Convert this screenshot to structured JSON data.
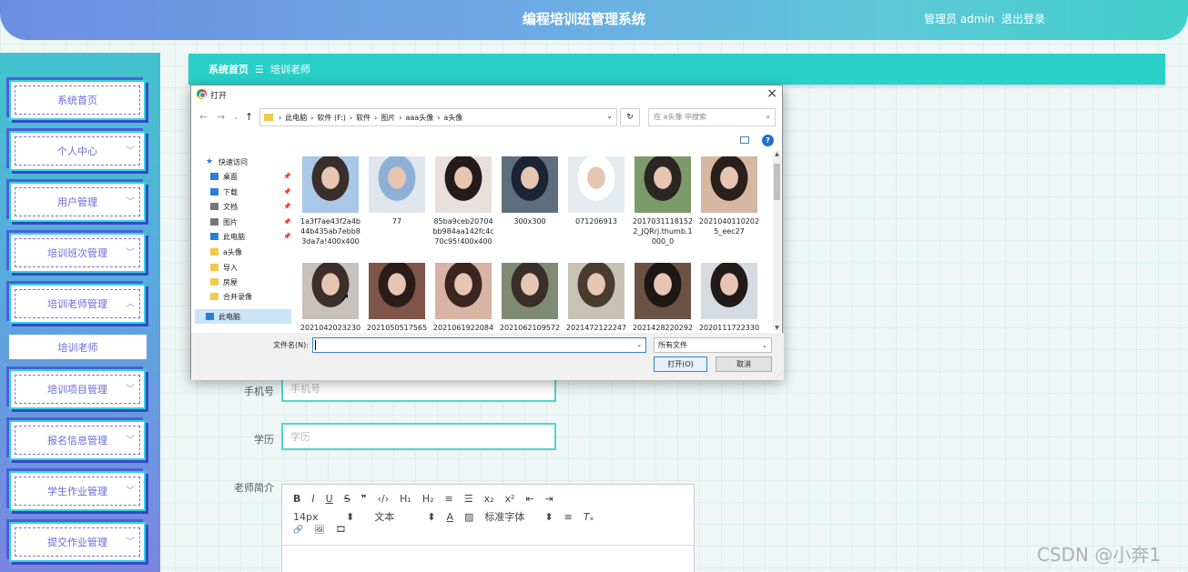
{
  "header": {
    "title": "编程培训班管理系统",
    "user": "管理员 admin",
    "logout": "退出登录"
  },
  "sidebar": {
    "items": [
      {
        "label": "系统首页",
        "chevron": ""
      },
      {
        "label": "个人中心",
        "chevron": "﹀"
      },
      {
        "label": "用户管理",
        "chevron": "﹀"
      },
      {
        "label": "培训班次管理",
        "chevron": "﹀"
      },
      {
        "label": "培训老师管理",
        "chevron": "︿"
      },
      {
        "label": "培训项目管理",
        "chevron": "﹀"
      },
      {
        "label": "报名信息管理",
        "chevron": "﹀"
      },
      {
        "label": "学生作业管理",
        "chevron": "﹀"
      },
      {
        "label": "提交作业管理",
        "chevron": "﹀"
      }
    ],
    "subitem": "培训老师"
  },
  "breadcrumb": {
    "home": "系统首页",
    "sep": "☰",
    "current": "培训老师"
  },
  "form": {
    "phone_label": "手机号",
    "phone_placeholder": "手机号",
    "edu_label": "学历",
    "edu_placeholder": "学历",
    "intro_label": "老师简介"
  },
  "editor": {
    "row1": [
      "B",
      "I",
      "U",
      "S",
      "❞",
      "‹/›",
      "H₁",
      "H₂",
      "≡",
      "☰",
      "x₂",
      "x²",
      "⇤",
      "⇥"
    ],
    "size": "14px",
    "format": "文本",
    "font": "标准字体",
    "row3": [
      "🔗",
      "🖼",
      "🎞"
    ]
  },
  "watermark": "CSDN @小奔1",
  "dialog": {
    "title": "打开",
    "close": "×",
    "path": [
      "此电脑",
      "软件 (F:)",
      "软件",
      "图片",
      "aaa头像",
      "a头像"
    ],
    "search_placeholder": "在 a头像 中搜索",
    "nav": [
      {
        "label": "快速访问",
        "icon": "star-icon",
        "color": "#1e7be0",
        "pin": false
      },
      {
        "label": "桌面",
        "icon": "desktop-icon",
        "color": "#2a7fd4",
        "pin": true
      },
      {
        "label": "下载",
        "icon": "download-icon",
        "color": "#2a7fd4",
        "pin": true
      },
      {
        "label": "文档",
        "icon": "document-icon",
        "color": "#777777",
        "pin": true
      },
      {
        "label": "图片",
        "icon": "pictures-icon",
        "color": "#777777",
        "pin": true
      },
      {
        "label": "此电脑",
        "icon": "computer-icon",
        "color": "#2a7fd4",
        "pin": true
      },
      {
        "label": "a头像",
        "icon": "folder-icon",
        "color": "#f2c94c",
        "pin": false
      },
      {
        "label": "导入",
        "icon": "folder-icon",
        "color": "#f2c94c",
        "pin": false
      },
      {
        "label": "房屋",
        "icon": "folder-icon",
        "color": "#f2c94c",
        "pin": false
      },
      {
        "label": "合并录像",
        "icon": "folder-icon",
        "color": "#f2c94c",
        "pin": false
      },
      {
        "label": "此电脑",
        "icon": "computer-icon",
        "color": "#2a7fd4",
        "pin": false
      }
    ],
    "files": [
      {
        "name": "1a3f7ae43f2a4b44b435ab7ebb83da7a!400x400",
        "colors": [
          "#a9c8e8",
          "#3a2e2a"
        ]
      },
      {
        "name": "77",
        "colors": [
          "#dfe6ee",
          "#8fb0d6"
        ]
      },
      {
        "name": "85ba9ceb20704bb984aa142fc4c70c95!400x400",
        "colors": [
          "#e8e0da",
          "#241c1c"
        ]
      },
      {
        "name": "300x300",
        "colors": [
          "#5f6e7e",
          "#1c2433"
        ]
      },
      {
        "name": "071206913",
        "colors": [
          "#e4eaf0",
          "#ffffff"
        ]
      },
      {
        "name": "20170311181522_JQRrj.thumb.1000_0",
        "colors": [
          "#7c9a6a",
          "#2b2523"
        ]
      },
      {
        "name": "20210401102025_eec27",
        "colors": [
          "#d6b7a2",
          "#2a1f1b"
        ]
      },
      {
        "name": "2021042023230",
        "colors": [
          "#c9c1bd",
          "#3b2e2b"
        ]
      },
      {
        "name": "2021050517565",
        "colors": [
          "#7e5548",
          "#2a1c18"
        ]
      },
      {
        "name": "2021061922084",
        "colors": [
          "#d9b3a4",
          "#3a2520"
        ]
      },
      {
        "name": "2021062109572",
        "colors": [
          "#7f8a74",
          "#3a2f28"
        ]
      },
      {
        "name": "2021472122247",
        "colors": [
          "#c8c2b4",
          "#4a3b30"
        ]
      },
      {
        "name": "2021428220292",
        "colors": [
          "#6c5244",
          "#1e1714"
        ]
      },
      {
        "name": "2020111722330",
        "colors": [
          "#d6dbe3",
          "#221a1a"
        ]
      }
    ],
    "filename_label": "文件名(N):",
    "filename_value": "",
    "filter": "所有文件",
    "open": "打开(O)",
    "cancel": "取消"
  }
}
